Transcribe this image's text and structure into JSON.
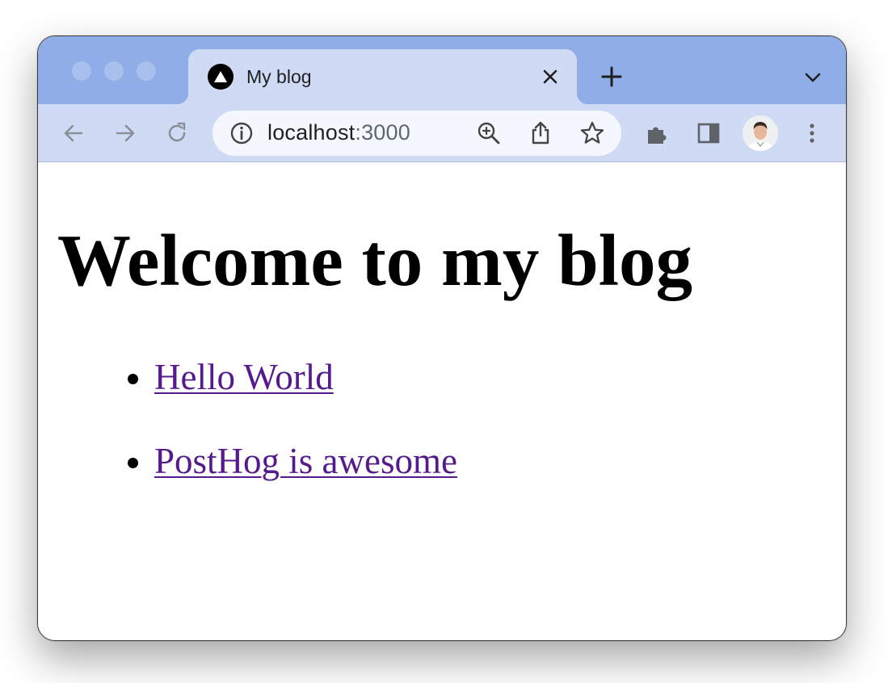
{
  "window": {
    "tab": {
      "title": "My blog",
      "favicon": "triangle-logo-icon"
    },
    "toolbar": {
      "url_host": "localhost",
      "url_port": ":3000",
      "icons": [
        "back-arrow-icon",
        "forward-arrow-icon",
        "reload-icon",
        "site-info-icon",
        "zoom-icon",
        "share-icon",
        "bookmark-star-icon",
        "extensions-puzzle-icon",
        "side-panel-icon",
        "profile-avatar",
        "more-menu-icon"
      ]
    }
  },
  "page": {
    "heading": "Welcome to my blog",
    "posts": [
      {
        "title": "Hello World"
      },
      {
        "title": "PostHog is awesome"
      }
    ]
  },
  "colors": {
    "tabstrip": "#8fade6",
    "toolbar": "#cfdbf5",
    "link_visited": "#551a8b"
  }
}
